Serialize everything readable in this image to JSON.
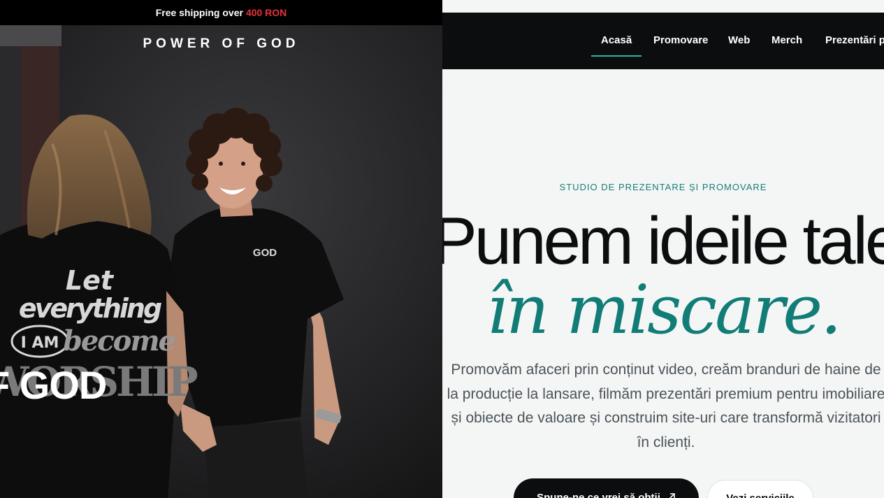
{
  "store": {
    "promo": {
      "text": "Free shipping over",
      "amount": "400 RON"
    },
    "brand": "POWER OF GOD",
    "hero_word": "F GOD",
    "shirt_print": {
      "line1": "Let",
      "line2": "everything",
      "badge": "I AM",
      "line3": "become",
      "line4": "WORSHIP",
      "chest_logo": "GOD"
    }
  },
  "studio": {
    "nav": [
      {
        "label": "Acasă",
        "active": true
      },
      {
        "label": "Promovare"
      },
      {
        "label": "Web"
      },
      {
        "label": "Merch"
      },
      {
        "label": "Prezentări pr"
      }
    ],
    "eyebrow": "STUDIO DE PREZENTARE ȘI PROMOVARE",
    "headline": "Punem ideile tale",
    "headline_accent": "în miscare.",
    "description": [
      "Promovăm afaceri prin conținut video, creăm branduri de haine de",
      "la producție la lansare, filmăm prezentări premium pentru imobiliare",
      "și obiecte de valoare și construim site-uri care transformă vizitatori",
      "în clienți."
    ],
    "cta_primary": "Spune-ne ce vrei să obții",
    "cta_primary_icon": "arrow-up-right-icon",
    "cta_secondary": "Vezi serviciile",
    "colors": {
      "accent": "#117d76",
      "nav_bg": "#0b0d0f",
      "promo_highlight": "#e8313a"
    }
  }
}
